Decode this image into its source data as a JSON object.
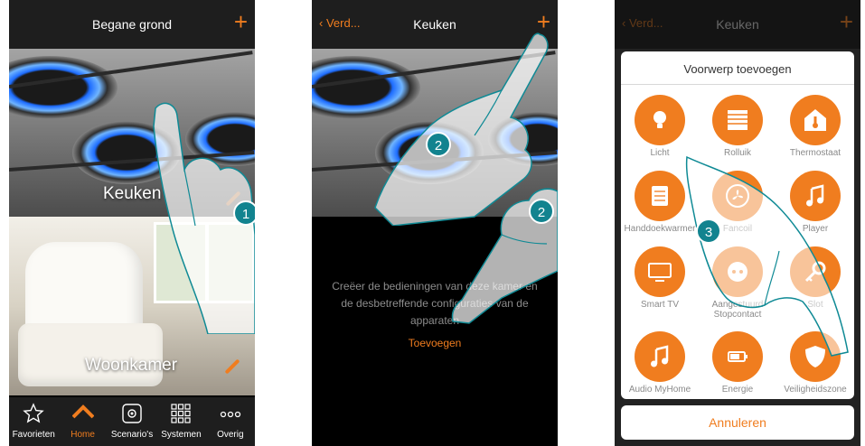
{
  "colors": {
    "accent": "#f07d1f",
    "bar": "#1e1e1e",
    "step_badge": "#12838f"
  },
  "screen1": {
    "title": "Begane grond",
    "add_icon": "+",
    "rooms": [
      {
        "name": "Keuken"
      },
      {
        "name": "Woonkamer"
      }
    ],
    "nav": [
      {
        "label": "Favorieten",
        "icon": "star-icon"
      },
      {
        "label": "Home",
        "icon": "home-icon"
      },
      {
        "label": "Scenario's",
        "icon": "scenario-icon"
      },
      {
        "label": "Systemen",
        "icon": "grid-icon"
      },
      {
        "label": "Overig",
        "icon": "more-icon"
      }
    ],
    "step": "1"
  },
  "screen2": {
    "back_label": "Verd...",
    "title": "Keuken",
    "add_icon": "+",
    "empty_message": "Creëer de bedieningen van deze kamer en de desbetreffende configuraties van de apparaten",
    "add_link": "Toevoegen",
    "steps": [
      "2",
      "2"
    ]
  },
  "screen3": {
    "back_label": "Verd...",
    "title": "Keuken",
    "add_icon": "+",
    "dialog_title": "Voorwerp toevoegen",
    "objects": [
      {
        "label": "Licht",
        "icon": "bulb-icon"
      },
      {
        "label": "Rolluik",
        "icon": "shutter-icon"
      },
      {
        "label": "Thermostaat",
        "icon": "thermostat-icon"
      },
      {
        "label": "Handdoekwarmer",
        "icon": "towel-warmer-icon"
      },
      {
        "label": "Fancoil",
        "icon": "fan-icon"
      },
      {
        "label": "Player",
        "icon": "music-note-icon"
      },
      {
        "label": "Smart TV",
        "icon": "tv-icon"
      },
      {
        "label": "Aangestuurd Stopcontact",
        "icon": "socket-icon"
      },
      {
        "label": "Slot",
        "icon": "key-icon"
      },
      {
        "label": "Audio MyHome",
        "icon": "music-note-icon"
      },
      {
        "label": "Energie",
        "icon": "battery-icon"
      },
      {
        "label": "Veiligheidszone",
        "icon": "shield-icon"
      }
    ],
    "cancel_label": "Annuleren",
    "step": "3"
  }
}
